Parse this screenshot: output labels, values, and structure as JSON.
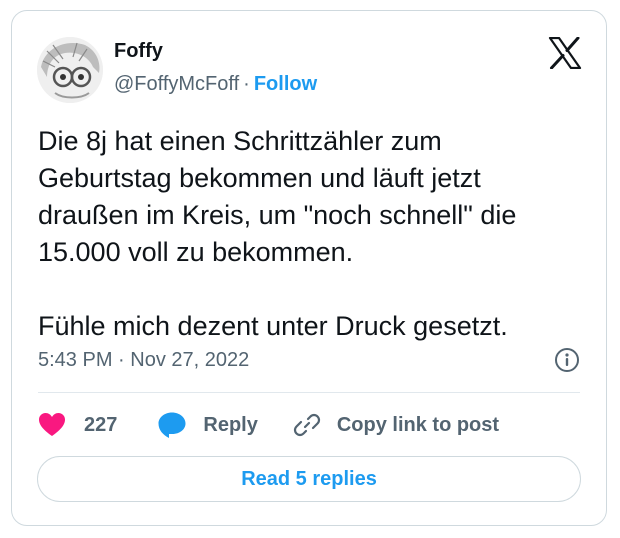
{
  "author": {
    "display_name": "Foffy",
    "handle": "@FoffyMcFoff",
    "separator": "·",
    "follow_label": "Follow"
  },
  "tweet": {
    "text": "Die 8j hat einen Schrittzähler zum\nGeburtstag bekommen und läuft jetzt\ndraußen im Kreis, um \"noch schnell\" die\n15.000 voll zu bekommen.\n\nFühle mich dezent unter Druck gesetzt.",
    "time": "5:43 PM",
    "separator": "·",
    "date": "Nov 27, 2022"
  },
  "actions": {
    "like_count": "227",
    "reply_label": "Reply",
    "copy_link_label": "Copy link to post"
  },
  "read_replies_label": "Read 5 replies",
  "icons": {
    "brand": "x-logo-icon",
    "info": "info-icon",
    "like": "heart-icon",
    "reply": "speech-bubble-icon",
    "copy_link": "link-icon"
  },
  "colors": {
    "accent": "#1d9bf0",
    "like": "#f91880",
    "text": "#0f1419",
    "muted": "#536471",
    "border": "#cfd9de"
  }
}
